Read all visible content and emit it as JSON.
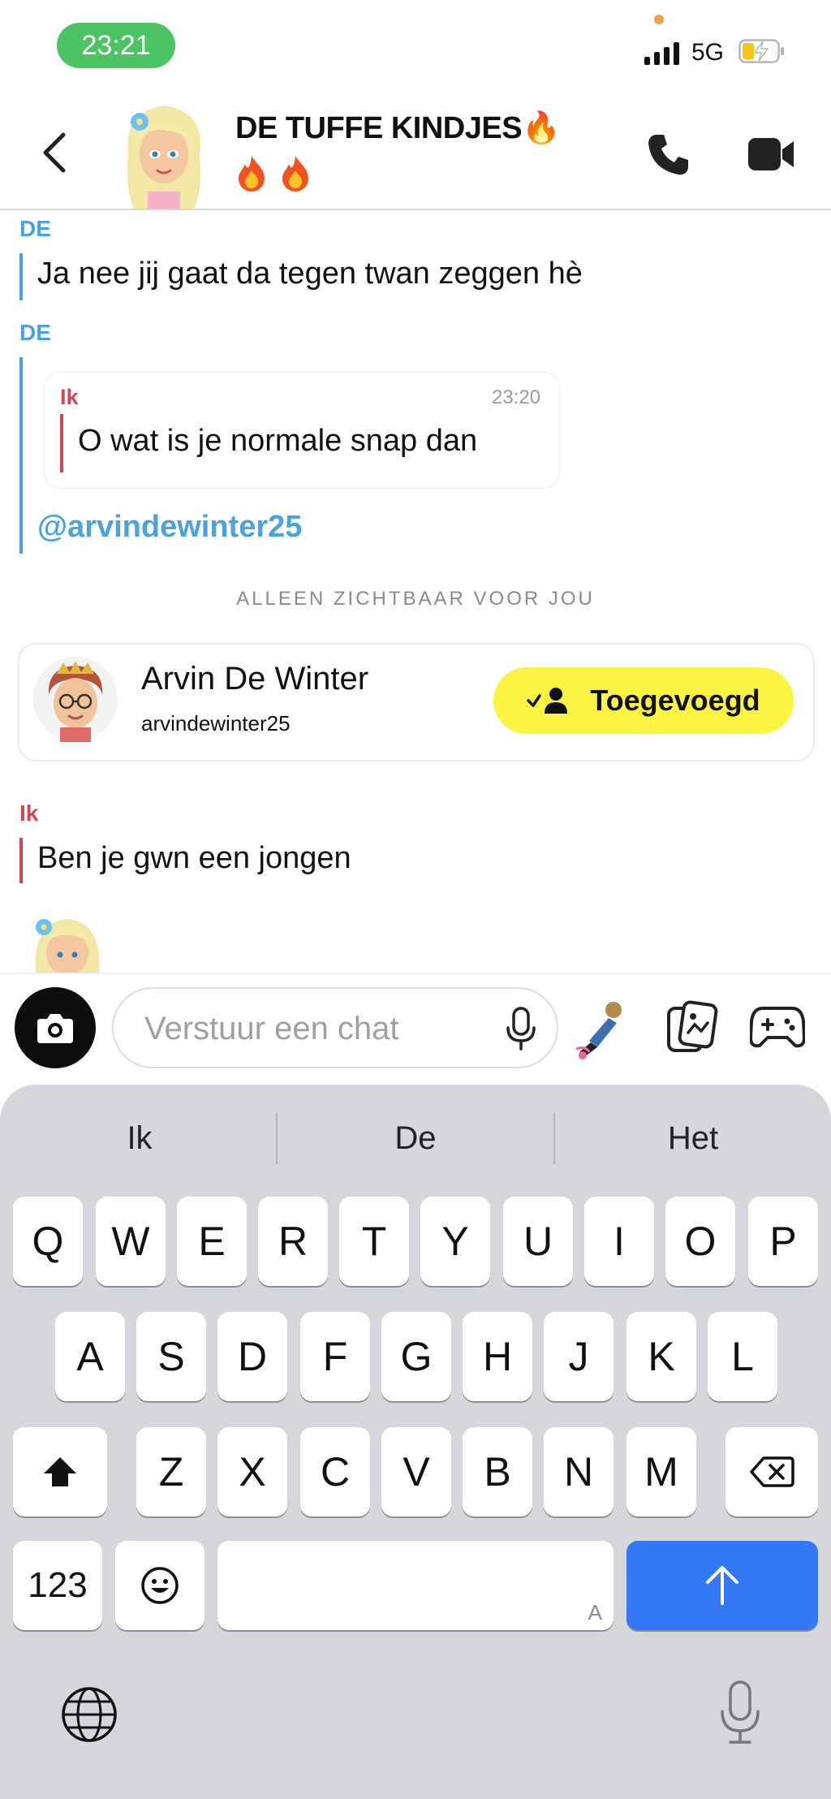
{
  "status_bar": {
    "time": "23:21",
    "network": "5G"
  },
  "header": {
    "title": "DE TUFFE KINDJES🔥",
    "title_emoji_line": "🔥🔥"
  },
  "messages": {
    "m1": {
      "sender": "DE",
      "text": "Ja nee jij gaat da tegen twan zeggen hè"
    },
    "m2": {
      "sender": "DE",
      "quote": {
        "sender": "Ik",
        "time": "23:20",
        "text": "O wat is je normale snap dan"
      },
      "mention": "@arvindewinter25"
    },
    "notice": "ALLEEN ZICHTBAAR VOOR JOU",
    "contact": {
      "name": "Arvin De Winter",
      "username": "arvindewinter25",
      "button_label": "Toegevoegd"
    },
    "m3": {
      "sender": "Ik",
      "text": "Ben je gwn een jongen"
    }
  },
  "composer": {
    "placeholder": "Verstuur een chat"
  },
  "keyboard": {
    "suggestions": [
      "Ik",
      "De",
      "Het"
    ],
    "row1": [
      "Q",
      "W",
      "E",
      "R",
      "T",
      "Y",
      "U",
      "I",
      "O",
      "P"
    ],
    "row2": [
      "A",
      "S",
      "D",
      "F",
      "G",
      "H",
      "J",
      "K",
      "L"
    ],
    "row3": [
      "Z",
      "X",
      "C",
      "V",
      "B",
      "N",
      "M"
    ],
    "numbers_label": "123",
    "space_hint": "A"
  }
}
